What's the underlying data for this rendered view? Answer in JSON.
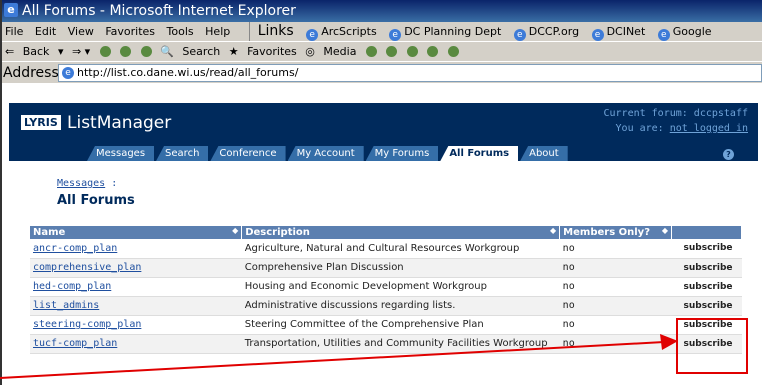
{
  "window": {
    "title": "All Forums - Microsoft Internet Explorer"
  },
  "menubar": {
    "items": [
      "File",
      "Edit",
      "View",
      "Favorites",
      "Tools",
      "Help"
    ],
    "links_label": "Links",
    "links": [
      "ArcScripts",
      "DC Planning Dept",
      "DCCP.org",
      "DCINet",
      "Google"
    ]
  },
  "toolbar": {
    "back": "Back",
    "search": "Search",
    "favorites": "Favorites",
    "media": "Media"
  },
  "address": {
    "label": "Address",
    "url": "http://list.co.dane.wi.us/read/all_forums/"
  },
  "lyris": {
    "logo": "LYRIS",
    "product": "ListManager",
    "current_forum": "Current forum: dccpstaff",
    "login_prefix": "You are: ",
    "login_link": "not logged in",
    "tabs": [
      "Messages",
      "Search",
      "Conference",
      "My Account",
      "My Forums",
      "All Forums",
      "About"
    ],
    "active_tab": "All Forums",
    "help": "?"
  },
  "breadcrumb": {
    "link": "Messages",
    "sep": " :"
  },
  "page_title": "All Forums",
  "table": {
    "headers": [
      "Name",
      "Description",
      "Members Only?",
      ""
    ],
    "rows": [
      {
        "name": "ancr-comp_plan",
        "description": "Agriculture, Natural and Cultural Resources Workgroup",
        "members": "no",
        "action": "subscribe"
      },
      {
        "name": "comprehensive_plan",
        "description": "Comprehensive Plan Discussion",
        "members": "no",
        "action": "subscribe"
      },
      {
        "name": "hed-comp_plan",
        "description": "Housing and Economic Development Workgroup",
        "members": "no",
        "action": "subscribe"
      },
      {
        "name": "list_admins",
        "description": "Administrative discussions regarding lists.",
        "members": "no",
        "action": "subscribe"
      },
      {
        "name": "steering-comp_plan",
        "description": "Steering Committee of the Comprehensive Plan",
        "members": "no",
        "action": "subscribe"
      },
      {
        "name": "tucf-comp_plan",
        "description": "Transportation, Utilities and Community Facilities Workgroup",
        "members": "no",
        "action": "subscribe"
      }
    ]
  },
  "annotation": {
    "color": "#e00000"
  }
}
